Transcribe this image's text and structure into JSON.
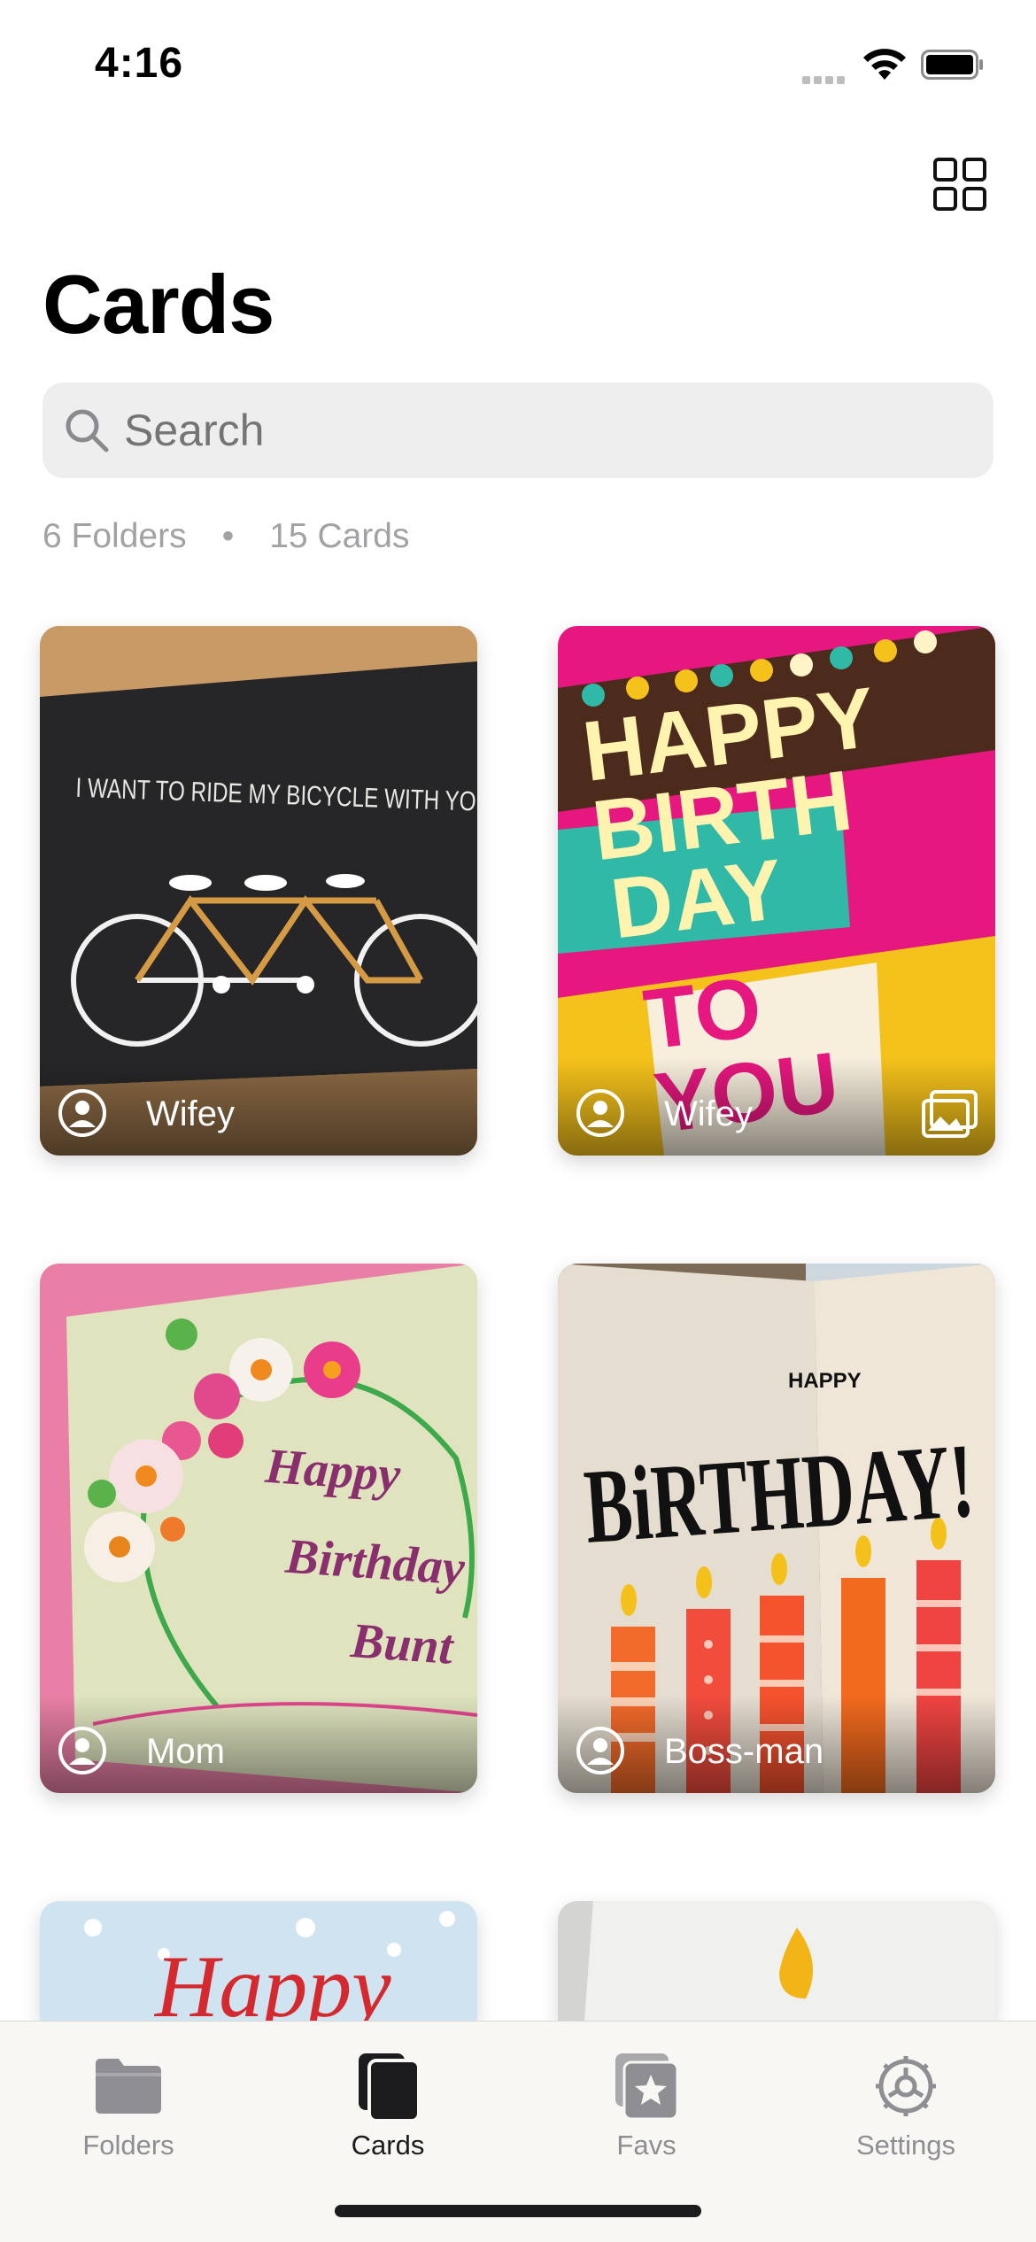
{
  "status_bar": {
    "time": "4:16"
  },
  "header": {
    "title": "Cards"
  },
  "search": {
    "placeholder": "Search"
  },
  "summary": {
    "folders": "6 Folders",
    "separator": "•",
    "cards": "15 Cards"
  },
  "cards": [
    {
      "label": "Wifey",
      "icon": "person-icon",
      "has_gallery": false
    },
    {
      "label": "Wifey",
      "icon": "person-icon",
      "has_gallery": true
    },
    {
      "label": "Mom",
      "icon": "person-icon",
      "has_gallery": false
    },
    {
      "label": "Boss-man",
      "icon": "person-icon",
      "has_gallery": false
    }
  ],
  "card_art": {
    "bicycle": "I WANT TO RIDE MY BICYCLE WITH YOU",
    "birthday": [
      "HAPPY",
      "BIRTH",
      "DAY",
      "TO",
      "YOU"
    ],
    "quilling": [
      "Happy",
      "Birthday",
      "Bunt"
    ],
    "candles_small": "HAPPY",
    "candles_big": "BiRTHDAY!",
    "partial_left": "Happy"
  },
  "tab_bar": {
    "tabs": [
      {
        "label": "Folders",
        "icon": "folder-icon",
        "active": false
      },
      {
        "label": "Cards",
        "icon": "cards-stack-icon",
        "active": true
      },
      {
        "label": "Favs",
        "icon": "star-folder-icon",
        "active": false
      },
      {
        "label": "Settings",
        "icon": "gear-icon",
        "active": false
      }
    ]
  },
  "colors": {
    "accent": "#1c1c1e",
    "inactive": "#8e8e93",
    "search_bg": "#eeeeef",
    "pink": "#e6177e",
    "teal": "#2fb9a6",
    "yellow": "#f5c21b"
  }
}
